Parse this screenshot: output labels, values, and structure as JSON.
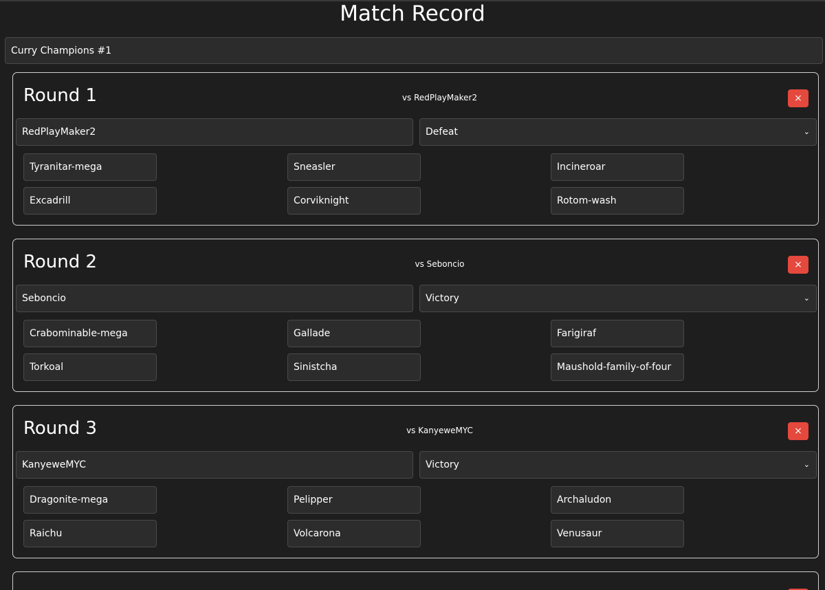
{
  "page": {
    "title": "Match Record",
    "team_name": "Curry Champions #1"
  },
  "rounds": [
    {
      "title": "Round 1",
      "vs": "vs RedPlayMaker2",
      "delete_icon": "×",
      "opponent": "RedPlayMaker2",
      "result": "Defeat",
      "pokemon": [
        "Tyranitar-mega",
        "Sneasler",
        "Incineroar",
        "Excadrill",
        "Corviknight",
        "Rotom-wash"
      ]
    },
    {
      "title": "Round 2",
      "vs": "vs Seboncio",
      "delete_icon": "×",
      "opponent": "Seboncio",
      "result": "Victory",
      "pokemon": [
        "Crabominable-mega",
        "Gallade",
        "Farigiraf",
        "Torkoal",
        "Sinistcha",
        "Maushold-family-of-four"
      ]
    },
    {
      "title": "Round 3",
      "vs": "vs KanyeweMYC",
      "delete_icon": "×",
      "opponent": "KanyeweMYC",
      "result": "Victory",
      "pokemon": [
        "Dragonite-mega",
        "Pelipper",
        "Archaludon",
        "Raichu",
        "Volcarona",
        "Venusaur"
      ]
    }
  ],
  "partial_round": {
    "delete_icon": "×"
  },
  "icons": {
    "delete": "close-icon",
    "select": "chevron-down-icon"
  },
  "colors": {
    "background": "#1e1e1e",
    "input_bg": "#2c2c2c",
    "delete_button": "#e5483d",
    "card_border": "#cfcfcf"
  }
}
